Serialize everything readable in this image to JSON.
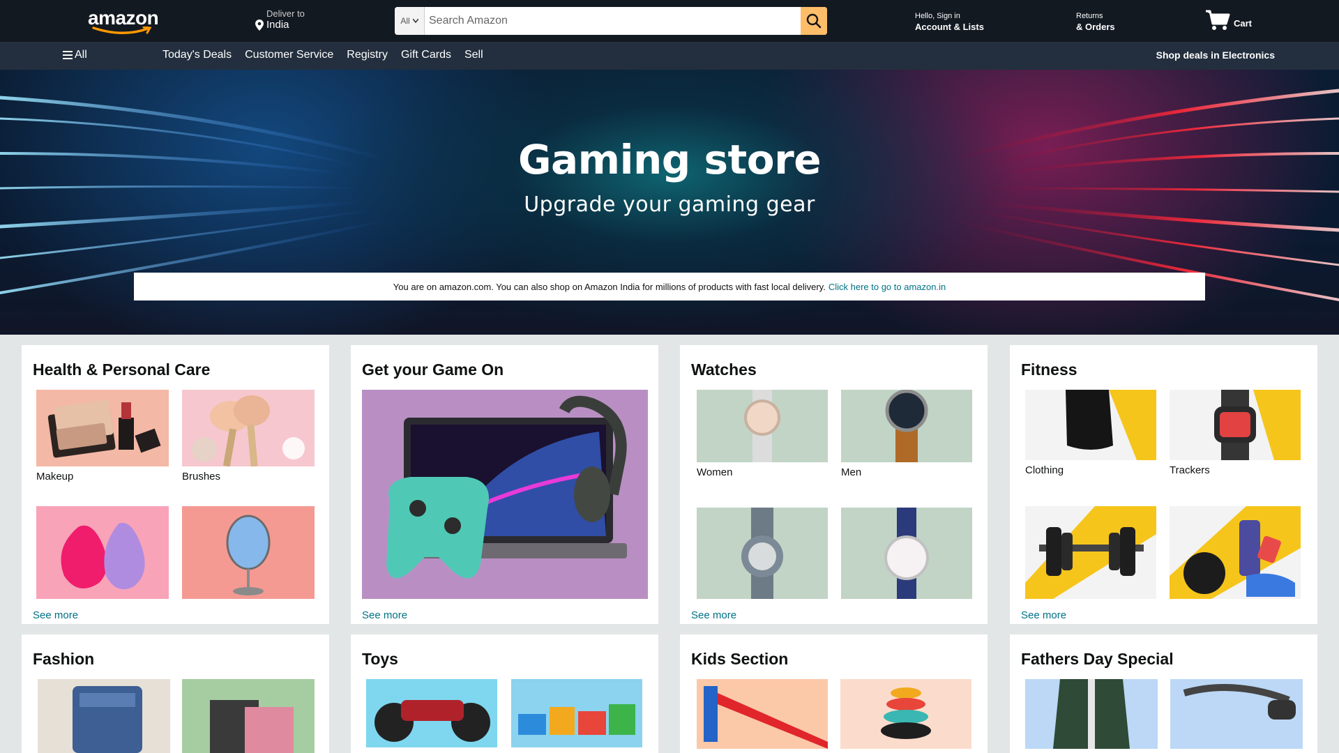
{
  "header": {
    "logo_text": "amazon",
    "deliver_label": "Deliver to",
    "deliver_location": "India",
    "search_category": "All",
    "search_placeholder": "Search Amazon",
    "account_line1": "Hello, Sign in",
    "account_line2": "Account & Lists",
    "returns_line1": "Returns",
    "returns_line2": "& Orders",
    "cart_label": "Cart"
  },
  "nav": {
    "all_label": "All",
    "links": [
      "Today's Deals",
      "Customer Service",
      "Registry",
      "Gift Cards",
      "Sell"
    ],
    "promo": "Shop deals in Electronics"
  },
  "hero": {
    "title": "Gaming store",
    "subtitle": "Upgrade your gaming gear",
    "notice_text": "You are on amazon.com. You can also shop on Amazon India for millions of products with fast local delivery.",
    "notice_link": "Click here to go to amazon.in"
  },
  "cards": [
    {
      "title": "Health & Personal Care",
      "see_more": "See more",
      "tiles": [
        "Makeup",
        "Brushes",
        "",
        ""
      ]
    },
    {
      "title": "Get your Game On",
      "see_more": "See more"
    },
    {
      "title": "Watches",
      "see_more": "See more",
      "tiles": [
        "Women",
        "Men",
        "",
        ""
      ]
    },
    {
      "title": "Fitness",
      "see_more": "See more",
      "tiles": [
        "Clothing",
        "Trackers",
        "",
        ""
      ]
    },
    {
      "title": "Fashion"
    },
    {
      "title": "Toys"
    },
    {
      "title": "Kids Section"
    },
    {
      "title": "Fathers Day Special"
    }
  ],
  "colors": {
    "header_bg": "#131921",
    "nav_bg": "#232f3e",
    "search_button": "#febd69",
    "link": "#007185",
    "page_bg": "#e3e6e6"
  }
}
